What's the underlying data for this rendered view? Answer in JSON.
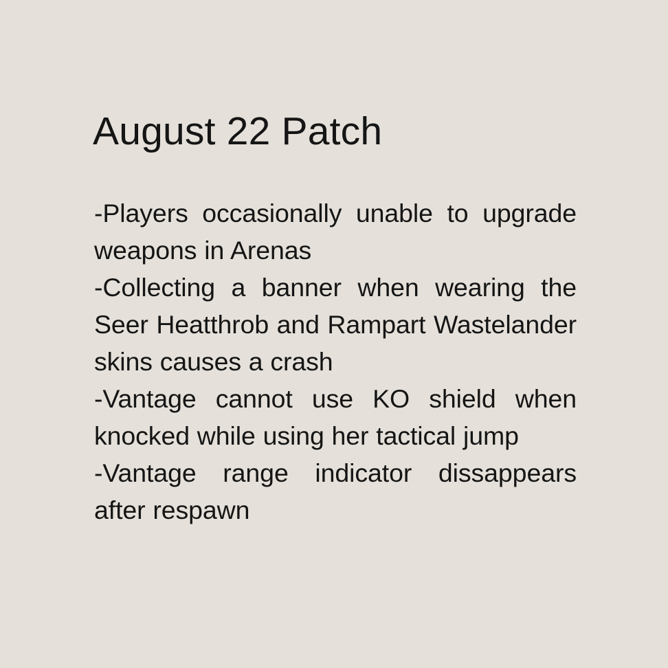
{
  "card": {
    "background_color": "#E5E1DA",
    "text_color": "#151515"
  },
  "header": {
    "title": "August 22 Patch"
  },
  "notes": {
    "items": [
      {
        "text": "-Players occasionally unable to upgrade weapons in Arenas"
      },
      {
        "text": "-Collecting a banner when wearing the Seer Heatthrob and Rampart Wastelander skins causes a crash"
      },
      {
        "text": "-Vantage cannot use KO shield when knocked while using her tactical jump"
      },
      {
        "text": "-Vantage range indicator dissappears after respawn"
      }
    ]
  }
}
